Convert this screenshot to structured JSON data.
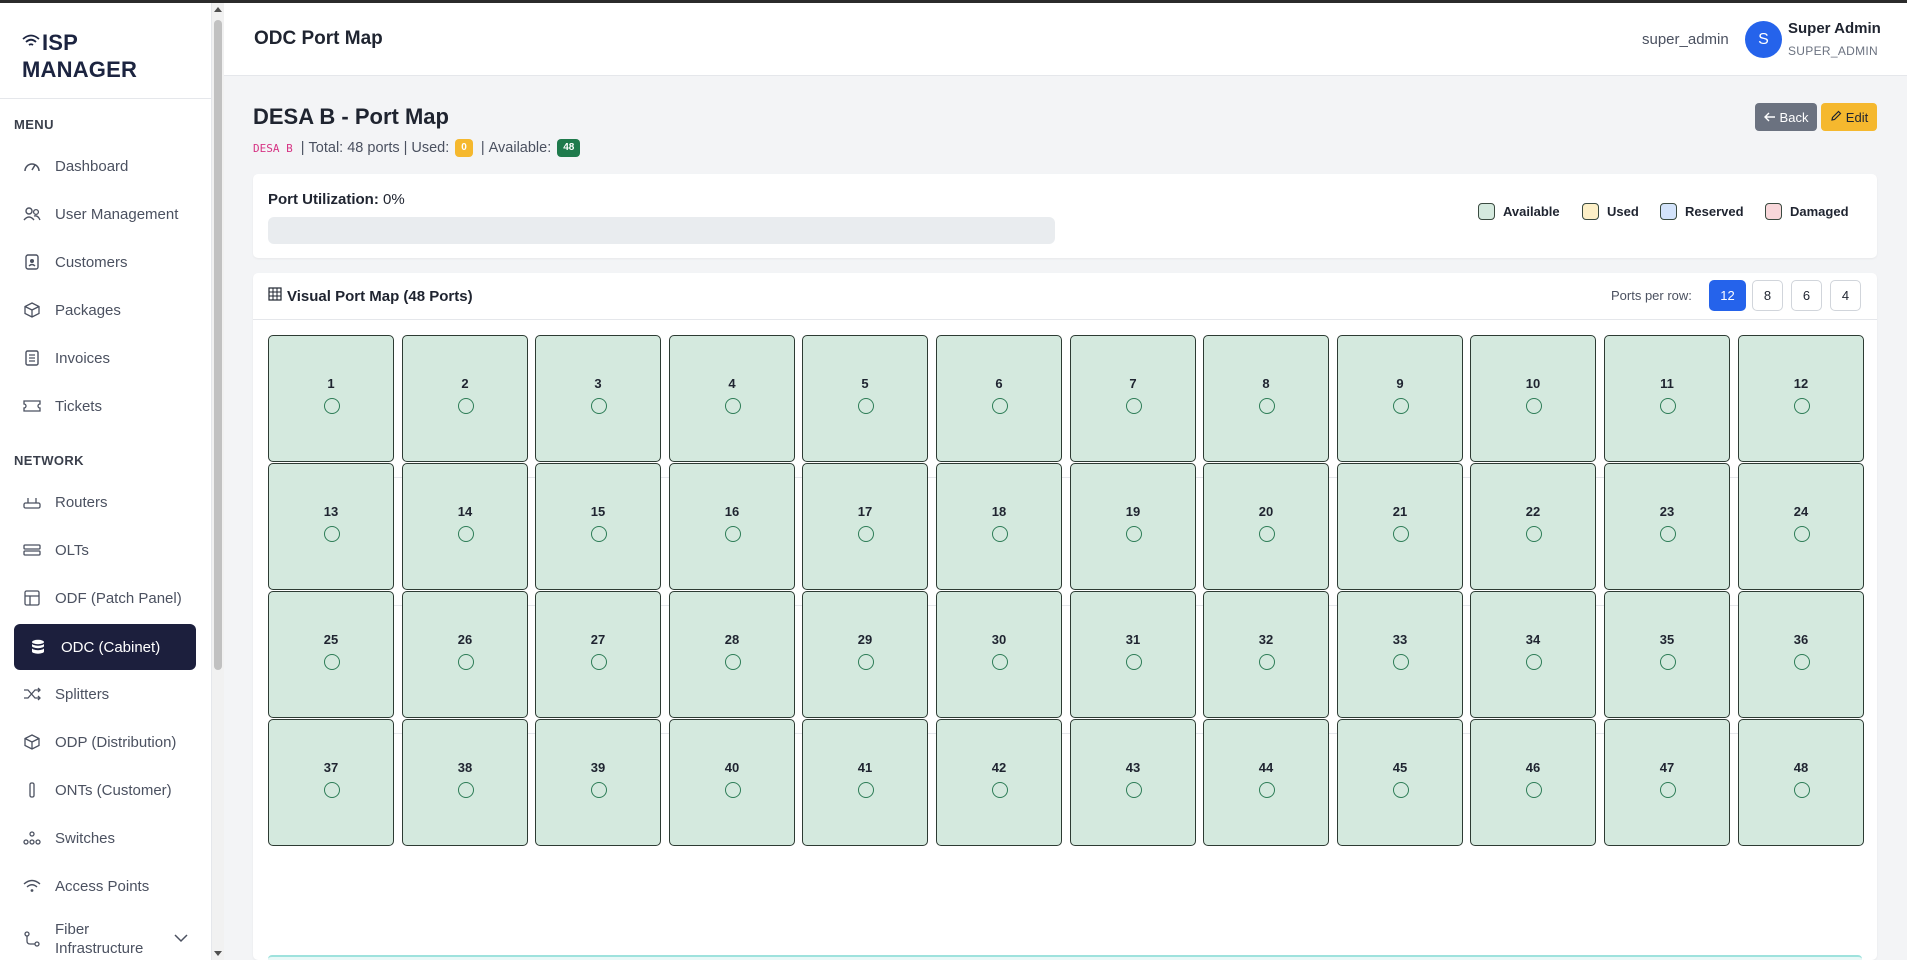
{
  "app": {
    "logo_line1": "ISP",
    "logo_line2": "MANAGER"
  },
  "sidebar": {
    "menu_title": "MENU",
    "network_title": "NETWORK",
    "menu_items": [
      {
        "label": "Dashboard",
        "icon": "gauge-icon"
      },
      {
        "label": "User Management",
        "icon": "users-icon"
      },
      {
        "label": "Customers",
        "icon": "id-card-icon"
      },
      {
        "label": "Packages",
        "icon": "box-icon"
      },
      {
        "label": "Invoices",
        "icon": "receipt-icon"
      },
      {
        "label": "Tickets",
        "icon": "ticket-icon"
      }
    ],
    "network_items": [
      {
        "label": "Routers",
        "icon": "router-icon"
      },
      {
        "label": "OLTs",
        "icon": "olt-icon"
      },
      {
        "label": "ODF (Patch Panel)",
        "icon": "patch-panel-icon"
      },
      {
        "label": "ODC (Cabinet)",
        "icon": "database-icon",
        "active": true
      },
      {
        "label": "Splitters",
        "icon": "shuffle-icon"
      },
      {
        "label": "ODP (Distribution)",
        "icon": "cube-icon"
      },
      {
        "label": "ONTs (Customer)",
        "icon": "ont-icon"
      },
      {
        "label": "Switches",
        "icon": "diagram-icon"
      },
      {
        "label": "Access Points",
        "icon": "wifi-icon"
      },
      {
        "label": "Fiber Infrastructure",
        "line1": "Fiber",
        "line2": "Infrastructure",
        "icon": "fiber-icon"
      }
    ]
  },
  "header": {
    "title": "ODC Port Map",
    "username": "super_admin",
    "avatar_letter": "S",
    "user_name": "Super Admin",
    "user_role": "SUPER_ADMIN"
  },
  "page": {
    "title": "DESA B - Port Map",
    "code": "DESA B",
    "total_text": "Total: 48 ports",
    "used_label": "Used:",
    "used_count": "0",
    "available_label": "Available:",
    "available_count": "48",
    "back_label": "Back",
    "edit_label": "Edit"
  },
  "utilization": {
    "label": "Port Utilization:",
    "value": "0%",
    "fraction": 0,
    "legend": [
      {
        "label": "Available",
        "bg": "#d4e9de",
        "border": "#3a4a40"
      },
      {
        "label": "Used",
        "bg": "#fdf0c7",
        "border": "#3a4a40"
      },
      {
        "label": "Reserved",
        "bg": "#d3e3fb",
        "border": "#3a4a40"
      },
      {
        "label": "Damaged",
        "bg": "#f8d7da",
        "border": "#3a4a40"
      }
    ]
  },
  "port_map": {
    "title": "Visual Port Map (48 Ports)",
    "ports_per_row_label": "Ports per row:",
    "ports_per_row_options": [
      "12",
      "8",
      "6",
      "4"
    ],
    "ports_per_row_selected": "12",
    "ports": [
      "1",
      "2",
      "3",
      "4",
      "5",
      "6",
      "7",
      "8",
      "9",
      "10",
      "11",
      "12",
      "13",
      "14",
      "15",
      "16",
      "17",
      "18",
      "19",
      "20",
      "21",
      "22",
      "23",
      "24",
      "25",
      "26",
      "27",
      "28",
      "29",
      "30",
      "31",
      "32",
      "33",
      "34",
      "35",
      "36",
      "37",
      "38",
      "39",
      "40",
      "41",
      "42",
      "43",
      "44",
      "45",
      "46",
      "47",
      "48"
    ],
    "port_status": "Available"
  },
  "colors": {
    "accent": "#2563eb",
    "sidebar_active": "#1c1f3d",
    "available": "#d4e9de",
    "used_badge": "#f5b82e",
    "available_badge": "#1f7a4c"
  }
}
